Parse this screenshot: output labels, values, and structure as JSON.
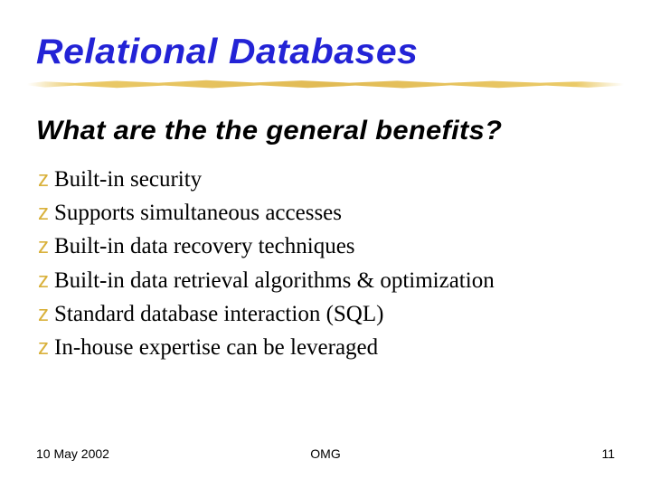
{
  "title": "Relational Databases",
  "subtitle": "What are the the general benefits?",
  "bullets": [
    "Built-in security",
    "Supports simultaneous accesses",
    "Built-in data recovery techniques",
    "Built-in data retrieval algorithms & optimization",
    "Standard database interaction (SQL)",
    "In-house expertise can be leveraged"
  ],
  "footer": {
    "date": "10 May 2002",
    "org": "OMG",
    "page": "11"
  },
  "bullet_glyph": "z"
}
